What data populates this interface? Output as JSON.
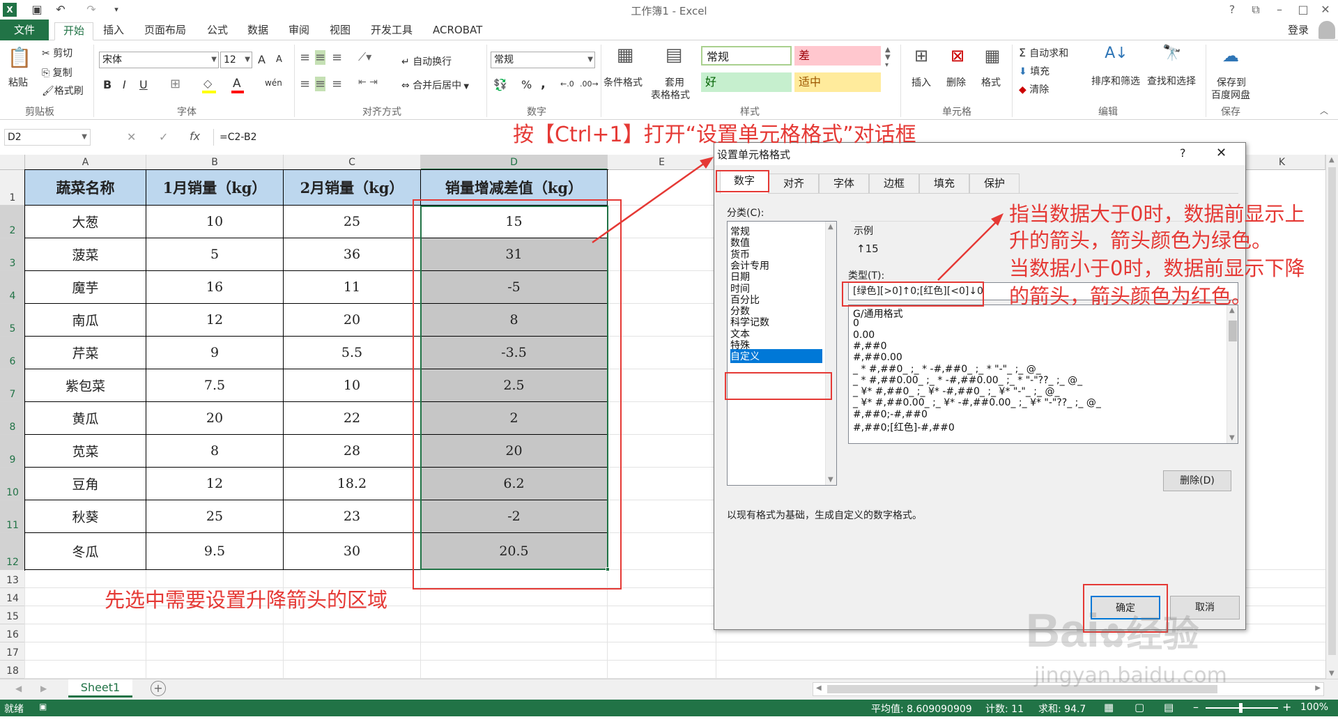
{
  "app": {
    "title": "工作簿1 - Excel",
    "login": "登录",
    "help": "?",
    "restore": "⧉",
    "minimize": "–",
    "maximize": "□",
    "close": "✕",
    "theme_color": "#217346"
  },
  "ribbon": {
    "tabs": [
      "文件",
      "开始",
      "插入",
      "页面布局",
      "公式",
      "数据",
      "审阅",
      "视图",
      "开发工具",
      "ACROBAT"
    ],
    "active_tab": "开始",
    "clipboard": {
      "paste": "粘贴",
      "cut": "剪切",
      "copy": "复制",
      "format_painter": "格式刷",
      "label": "剪贴板"
    },
    "font": {
      "name": "宋体",
      "size": "12",
      "grow": "A",
      "shrink": "A",
      "bold": "B",
      "italic": "I",
      "underline": "U",
      "label": "字体",
      "font_color_letter": "A",
      "phonetic": "wén"
    },
    "alignment": {
      "wrap": "自动换行",
      "merge": "合并后居中",
      "label": "对齐方式"
    },
    "number": {
      "format": "常规",
      "percent": "%",
      "comma": ",",
      "label": "数字"
    },
    "styles": {
      "conditional": "条件格式",
      "table_line1": "套用",
      "table_line2": "表格格式",
      "normal": "常规",
      "bad": "差",
      "good": "好",
      "neutral": "适中",
      "label": "样式",
      "normal_color": "#ffffff",
      "bad_color": "#ffc7ce",
      "good_color": "#c6efce",
      "neutral_color": "#ffeb9c"
    },
    "cells": {
      "insert": "插入",
      "delete": "删除",
      "format": "格式",
      "label": "单元格"
    },
    "editing": {
      "autosum": "自动求和",
      "fill": "填充",
      "clear": "清除",
      "sort": "排序和筛选",
      "find": "查找和选择",
      "label": "编辑"
    },
    "save": {
      "line1": "保存到",
      "line2": "百度网盘",
      "label": "保存"
    }
  },
  "formula_bar": {
    "name_box": "D2",
    "cancel": "✕",
    "enter": "✓",
    "fx": "fx",
    "formula": "=C2-B2"
  },
  "sheet": {
    "columns": [
      "A",
      "B",
      "C",
      "D",
      "E",
      "K"
    ],
    "rows": [
      "1",
      "2",
      "3",
      "4",
      "5",
      "6",
      "7",
      "8",
      "9",
      "10",
      "11",
      "12",
      "13",
      "14",
      "15",
      "16",
      "17",
      "18"
    ],
    "headers": [
      "蔬菜名称",
      "1月销量（kg）",
      "2月销量（kg）",
      "销量增减差值（kg）"
    ],
    "data": [
      [
        "大葱",
        "10",
        "25",
        "15"
      ],
      [
        "菠菜",
        "5",
        "36",
        "31"
      ],
      [
        "魔芋",
        "16",
        "11",
        "-5"
      ],
      [
        "南瓜",
        "12",
        "20",
        "8"
      ],
      [
        "芹菜",
        "9",
        "5.5",
        "-3.5"
      ],
      [
        "紫包菜",
        "7.5",
        "10",
        "2.5"
      ],
      [
        "黄瓜",
        "20",
        "22",
        "2"
      ],
      [
        "苋菜",
        "8",
        "28",
        "20"
      ],
      [
        "豆角",
        "12",
        "18.2",
        "6.2"
      ],
      [
        "秋葵",
        "25",
        "23",
        "-2"
      ],
      [
        "冬瓜",
        "9.5",
        "30",
        "20.5"
      ]
    ],
    "header_fill": "#bdd7ee",
    "selection_fill": "#c6c6c6",
    "tab_name": "Sheet1",
    "add_sheet": "+"
  },
  "dialog": {
    "title": "设置单元格格式",
    "help": "?",
    "close": "✕",
    "tabs": [
      "数字",
      "对齐",
      "字体",
      "边框",
      "填充",
      "保护"
    ],
    "category_label": "分类(C):",
    "categories": [
      "常规",
      "数值",
      "货币",
      "会计专用",
      "日期",
      "时间",
      "百分比",
      "分数",
      "科学记数",
      "文本",
      "特殊",
      "自定义"
    ],
    "selected_category": "自定义",
    "sample_label": "示例",
    "sample_value": "↑15",
    "type_label": "类型(T):",
    "type_value": "[绿色][>0]↑0;[红色][<0]↓0",
    "formats": [
      "G/通用格式",
      "0",
      "0.00",
      "#,##0",
      "#,##0.00",
      "_ * #,##0_ ;_ * -#,##0_ ;_ * \"-\"_ ;_ @_",
      "_ * #,##0.00_ ;_ * -#,##0.00_ ;_ * \"-\"??_ ;_ @_",
      "_ ¥* #,##0_ ;_ ¥* -#,##0_ ;_ ¥* \"-\"_ ;_ @_",
      "_ ¥* #,##0.00_ ;_ ¥* -#,##0.00_ ;_ ¥* \"-\"??_ ;_ @_",
      "#,##0;-#,##0",
      "#,##0;[红色]-#,##0"
    ],
    "delete_button": "删除(D)",
    "description": "以现有格式为基础，生成自定义的数字格式。",
    "ok_button": "确定",
    "cancel_button": "取消"
  },
  "annotations": {
    "top": "按【Ctrl+1】打开“设置单元格格式”对话框",
    "right_line1": "指当数据大于0时，数据前显示上",
    "right_line2": "升的箭头，箭头颜色为绿色。",
    "right_line3": "当数据小于0时，数据前显示下降",
    "right_line4": "的箭头，箭头颜色为红色。",
    "bottom": "先选中需要设置升降箭头的区域",
    "color": "#e53935"
  },
  "status": {
    "ready": "就绪",
    "average": "平均值: 8.609090909",
    "count": "计数: 11",
    "sum": "求和: 94.7",
    "zoom": "100%",
    "zoom_minus": "–",
    "zoom_plus": "+"
  },
  "watermark": {
    "brand": "Bai",
    "brand2": "经验",
    "url": "jingyan.baidu.com"
  }
}
